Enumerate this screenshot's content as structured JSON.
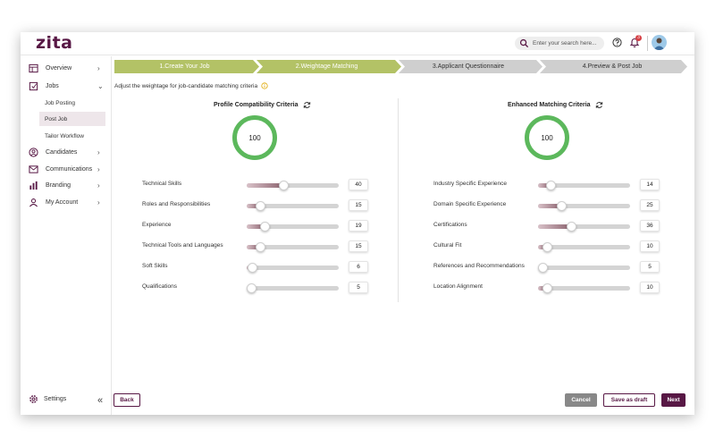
{
  "app": {
    "logo": "zita"
  },
  "header": {
    "search_placeholder": "Enter your search here...",
    "notification_count": "3",
    "icons": [
      "search-icon",
      "help-icon",
      "bell-icon",
      "avatar"
    ]
  },
  "sidebar": {
    "overview": "Overview",
    "jobs": "Jobs",
    "job_posting": "Job Posting",
    "post_job": "Post Job",
    "tailor_workflow": "Tailor Workflow",
    "candidates": "Candidates",
    "communications": "Communications",
    "branding": "Branding",
    "my_account": "My Account",
    "settings": "Settings"
  },
  "steps": [
    {
      "label": "1.Create Your Job",
      "status": "done"
    },
    {
      "label": "2.Weightage Matching",
      "status": "active"
    },
    {
      "label": "3.Applicant Questionnaire",
      "status": "pending"
    },
    {
      "label": "4.Preview & Post Job",
      "status": "pending"
    }
  ],
  "main": {
    "subtitle": "Adjust the weightage for job-candidate matching criteria",
    "profile": {
      "title": "Profile Compatibility Criteria",
      "total": "100",
      "items": [
        {
          "label": "Technical Skills",
          "value": "40",
          "fraction": 0.4
        },
        {
          "label": "Roles and Responsibilities",
          "value": "15",
          "fraction": 0.15
        },
        {
          "label": "Experience",
          "value": "19",
          "fraction": 0.19
        },
        {
          "label": "Technical Tools and Languages",
          "value": "15",
          "fraction": 0.15
        },
        {
          "label": "Soft Skills",
          "value": "6",
          "fraction": 0.06
        },
        {
          "label": "Qualifications",
          "value": "5",
          "fraction": 0.05
        }
      ]
    },
    "enhanced": {
      "title": "Enhanced Matching Criteria",
      "total": "100",
      "items": [
        {
          "label": "Industry Specific Experience",
          "value": "14",
          "fraction": 0.14
        },
        {
          "label": "Domain Specific Experience",
          "value": "25",
          "fraction": 0.25
        },
        {
          "label": "Certifications",
          "value": "36",
          "fraction": 0.36
        },
        {
          "label": "Cultural Fit",
          "value": "10",
          "fraction": 0.1
        },
        {
          "label": "References and Recommendations",
          "value": "5",
          "fraction": 0.05
        },
        {
          "label": "Location Alignment",
          "value": "10",
          "fraction": 0.1
        }
      ]
    }
  },
  "footer": {
    "back": "Back",
    "cancel": "Cancel",
    "save_draft": "Save as draft",
    "next": "Next"
  },
  "colors": {
    "brand": "#581845",
    "step_done": "#b3c266",
    "step_pending": "#cfcfcf",
    "ring": "#5cb85c"
  }
}
